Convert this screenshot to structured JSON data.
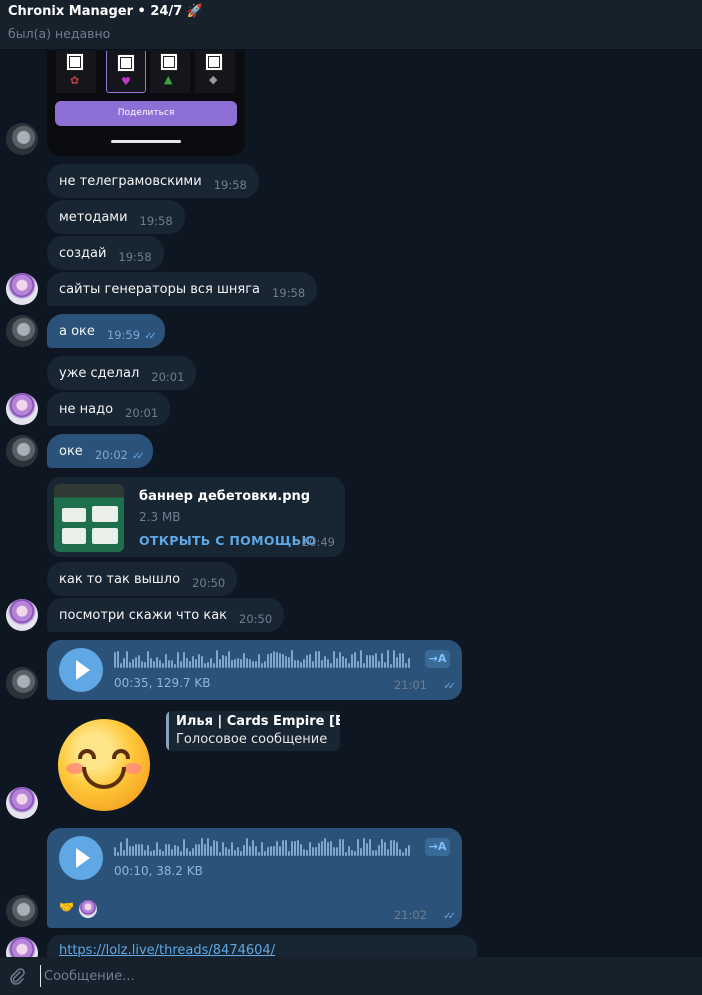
{
  "header": {
    "title": "Chronix Manager • 24/7 🚀",
    "status": "был(а) недавно"
  },
  "image_bubble": {
    "share_label": "Поделиться"
  },
  "messages": [
    {
      "text": "не телеграмовскими",
      "time": "19:58"
    },
    {
      "text": "методами",
      "time": "19:58"
    },
    {
      "text": "создай",
      "time": "19:58"
    },
    {
      "text": "сайты генераторы вся шняга",
      "time": "19:58"
    },
    {
      "text": "а оке",
      "time": "19:59"
    },
    {
      "text": "уже сделал",
      "time": "20:01"
    },
    {
      "text": "не надо",
      "time": "20:01"
    },
    {
      "text": "оке",
      "time": "20:02"
    },
    {
      "text": "как то так вышло",
      "time": "20:50"
    },
    {
      "text": "посмотри скажи что как",
      "time": "20:50"
    }
  ],
  "file": {
    "name": "баннер дебетовки.png",
    "size": "2.3 MB",
    "open_label": "ОТКРЫТЬ С ПОМОЩЬЮ",
    "time": "20:49"
  },
  "voices": [
    {
      "meta": "00:35, 129.7 KB",
      "time": "21:01",
      "transcribe": "→A"
    },
    {
      "meta": "00:10, 38.2 KB",
      "time": "21:02",
      "transcribe": "→A"
    }
  ],
  "reply": {
    "name": "Илья | Cards Empire [B...",
    "text": "Голосовое сообщение"
  },
  "reactions": {
    "emoji": "🤝"
  },
  "link": "https://lolz.live/threads/8474604/",
  "composer": {
    "placeholder": "Сообщение..."
  },
  "colors": {
    "background": "#0e1621",
    "incoming": "#182533",
    "outgoing": "#2b5278",
    "accent": "#5fa8e5"
  }
}
